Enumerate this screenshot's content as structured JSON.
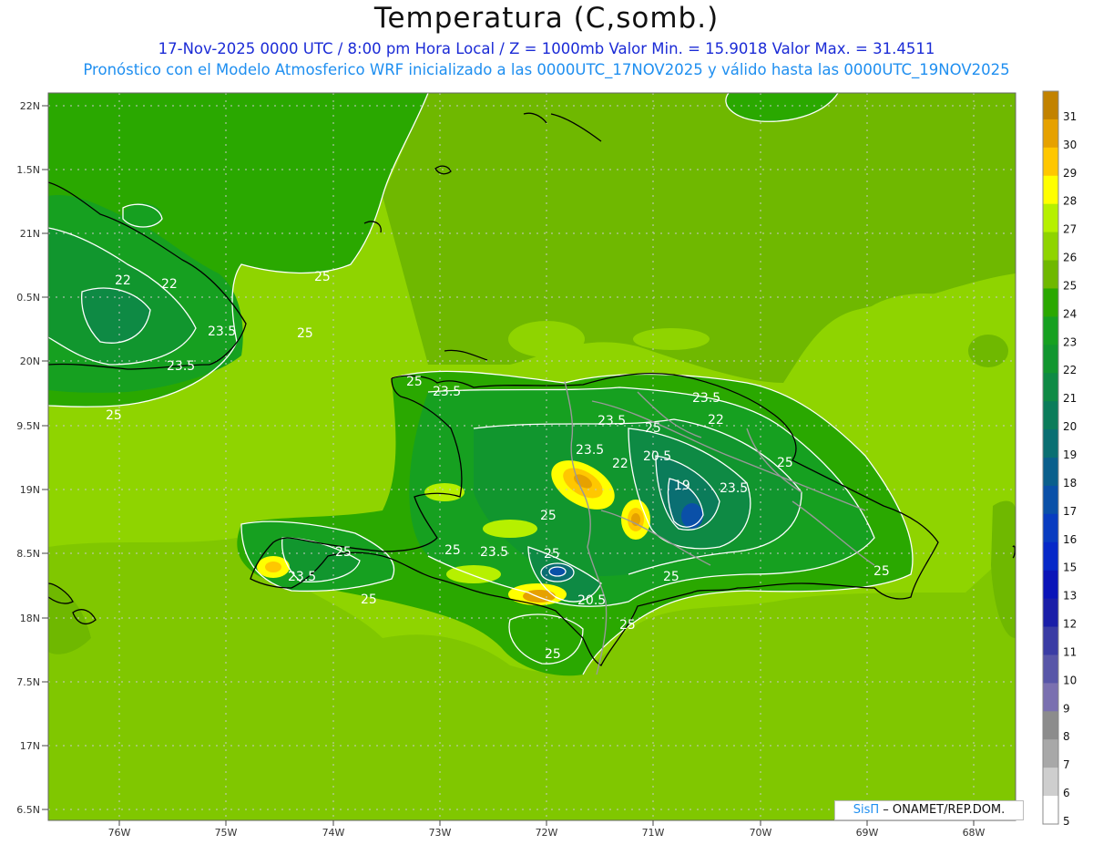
{
  "title": "Temperatura (C,somb.)",
  "subtitle_line1": "17-Nov-2025  0000 UTC / 8:00 pm Hora Local / Z = 1000mb    Valor Min. = 15.9018  Valor Max. = 31.4511",
  "subtitle_line2": "Pronóstico con el Modelo Atmosferico WRF inicializado a las 0000UTC_17NOV2025 y válido hasta las  0000UTC_19NOV2025",
  "lat_labels": [
    "22N",
    "1.5N",
    "21N",
    "0.5N",
    "20N",
    "9.5N",
    "19N",
    "8.5N",
    "18N",
    "7.5N",
    "17N",
    "6.5N"
  ],
  "lon_labels": [
    "76W",
    "75W",
    "74W",
    "73W",
    "72W",
    "71W",
    "70W",
    "69W",
    "68W"
  ],
  "colorbar": {
    "labels": [
      "31",
      "30",
      "29",
      "28",
      "27",
      "26",
      "25",
      "24",
      "23",
      "22",
      "21",
      "20",
      "19",
      "18",
      "17",
      "16",
      "15",
      "13",
      "12",
      "11",
      "10",
      "9",
      "8",
      "7",
      "6",
      "5"
    ],
    "colors": [
      "#c28200",
      "#e6a100",
      "#ffc700",
      "#ffff00",
      "#b6f000",
      "#8fd400",
      "#6fb800",
      "#2aa800",
      "#16a020",
      "#11962e",
      "#0e8a44",
      "#0b7c5a",
      "#0a6f72",
      "#0a5f8c",
      "#0a50a8",
      "#083cc0",
      "#0628c8",
      "#0a14b8",
      "#1a1ea8",
      "#3a3ca4",
      "#5856a8",
      "#7a70b0",
      "#8c8c8c",
      "#a8a8a8",
      "#cecece",
      "#ffffff"
    ]
  },
  "contour_labels": [
    {
      "text": "25"
    },
    {
      "text": "22"
    },
    {
      "text": "22"
    },
    {
      "text": "23.5"
    },
    {
      "text": "25"
    },
    {
      "text": "23.5"
    },
    {
      "text": "25"
    },
    {
      "text": "25"
    },
    {
      "text": "23.5"
    },
    {
      "text": "23.5"
    },
    {
      "text": "25"
    },
    {
      "text": "23.5"
    },
    {
      "text": "22"
    },
    {
      "text": "20.5"
    },
    {
      "text": "19"
    },
    {
      "text": "22"
    },
    {
      "text": "23.5"
    },
    {
      "text": "25"
    },
    {
      "text": "25"
    },
    {
      "text": "25"
    },
    {
      "text": "23.5"
    },
    {
      "text": "25"
    },
    {
      "text": "23.5"
    },
    {
      "text": "25"
    },
    {
      "text": "25"
    },
    {
      "text": "20.5"
    },
    {
      "text": "25"
    },
    {
      "text": "25"
    },
    {
      "text": "25"
    },
    {
      "text": "23.5"
    },
    {
      "text": "25"
    }
  ],
  "credit": {
    "logo": "SisΠ",
    "text": "– ONAMET/REP.DOM."
  }
}
